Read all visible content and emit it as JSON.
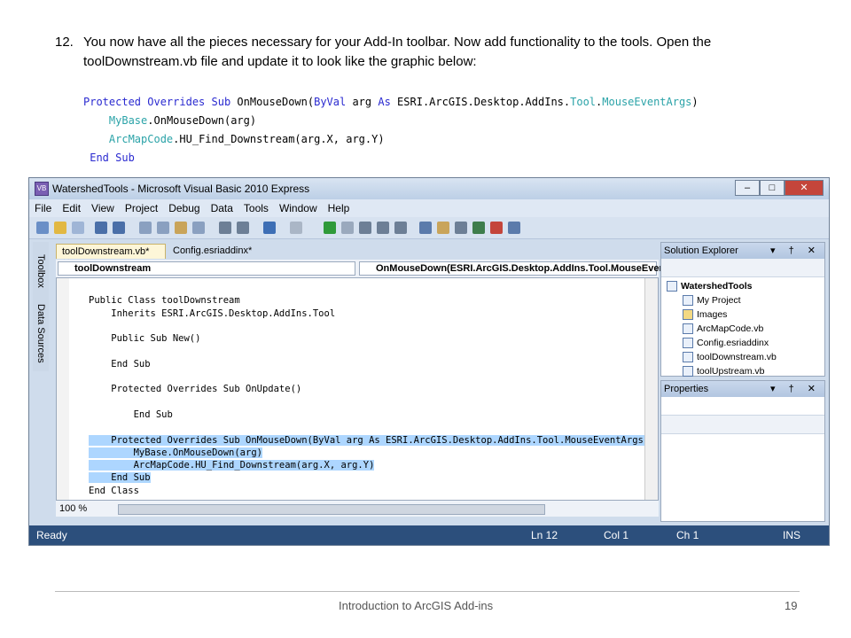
{
  "step": {
    "number": "12.",
    "text": "You now have all the pieces necessary for your Add-In toolbar.  Now add functionality to the tools.  Open the toolDownstream.vb file and update it to look like the graphic below:"
  },
  "doc_code": {
    "l1a": "Protected Overrides Sub ",
    "l1b": "OnMouseDown(",
    "l1c": "ByVal ",
    "l1d": "arg ",
    "l1e": "As ",
    "l1f": "ESRI.ArcGIS.Desktop.AddIns.",
    "l1g": "Tool",
    ".l1h": ".",
    "l1i": "MouseEventArgs",
    "l1j": ")",
    "l2a": "MyBase",
    ".l2b": ".",
    "l2c": "OnMouseDown(arg)",
    "l3a": "ArcMapCode",
    ".l3b": ".",
    "l3c": "HU_Find_Downstream(arg.X, arg.Y)",
    "l4": "End Sub"
  },
  "window": {
    "title": "WatershedTools - Microsoft Visual Basic 2010 Express",
    "controls": [
      "–",
      "□",
      "✕"
    ]
  },
  "menu": [
    "File",
    "Edit",
    "View",
    "Project",
    "Debug",
    "Data",
    "Tools",
    "Window",
    "Help"
  ],
  "left_strip": {
    "toolbox": "Toolbox",
    "datasources": "Data Sources"
  },
  "tabs": {
    "active": "toolDownstream.vb*",
    "other": "Config.esriaddinx*"
  },
  "nav": {
    "class_combo": "toolDownstream",
    "method_combo": "OnMouseDown(ESRI.ArcGIS.Desktop.AddIns.Tool.MouseEven"
  },
  "editor_lines": [
    "Public Class toolDownstream",
    "    Inherits ESRI.ArcGIS.Desktop.AddIns.Tool",
    "",
    "    Public Sub New()",
    "",
    "    End Sub",
    "",
    "    Protected Overrides Sub OnUpdate()",
    "",
    "        End Sub",
    "",
    "    Protected Overrides Sub OnMouseDown(ByVal arg As ESRI.ArcGIS.Desktop.AddIns.Tool.MouseEventArgs)",
    "        MyBase.OnMouseDown(arg)",
    "        ArcMapCode.HU_Find_Downstream(arg.X, arg.Y)",
    "    End Sub",
    "End Class"
  ],
  "zoom": "100 %",
  "status": {
    "ready": "Ready",
    "line": "Ln 12",
    "col": "Col 1",
    "ch": "Ch 1",
    "mode": "INS"
  },
  "solution_explorer": {
    "title": "Solution Explorer",
    "icons": "▾ † ✕",
    "items": [
      "WatershedTools",
      "My Project",
      "Images",
      "ArcMapCode.vb",
      "Config.esriaddinx",
      "toolDownstream.vb",
      "toolUpstream.vb"
    ]
  },
  "properties": {
    "title": "Properties",
    "icons": "▾ † ✕"
  },
  "footer": {
    "title": "Introduction to ArcGIS Add-ins",
    "page": "19"
  }
}
